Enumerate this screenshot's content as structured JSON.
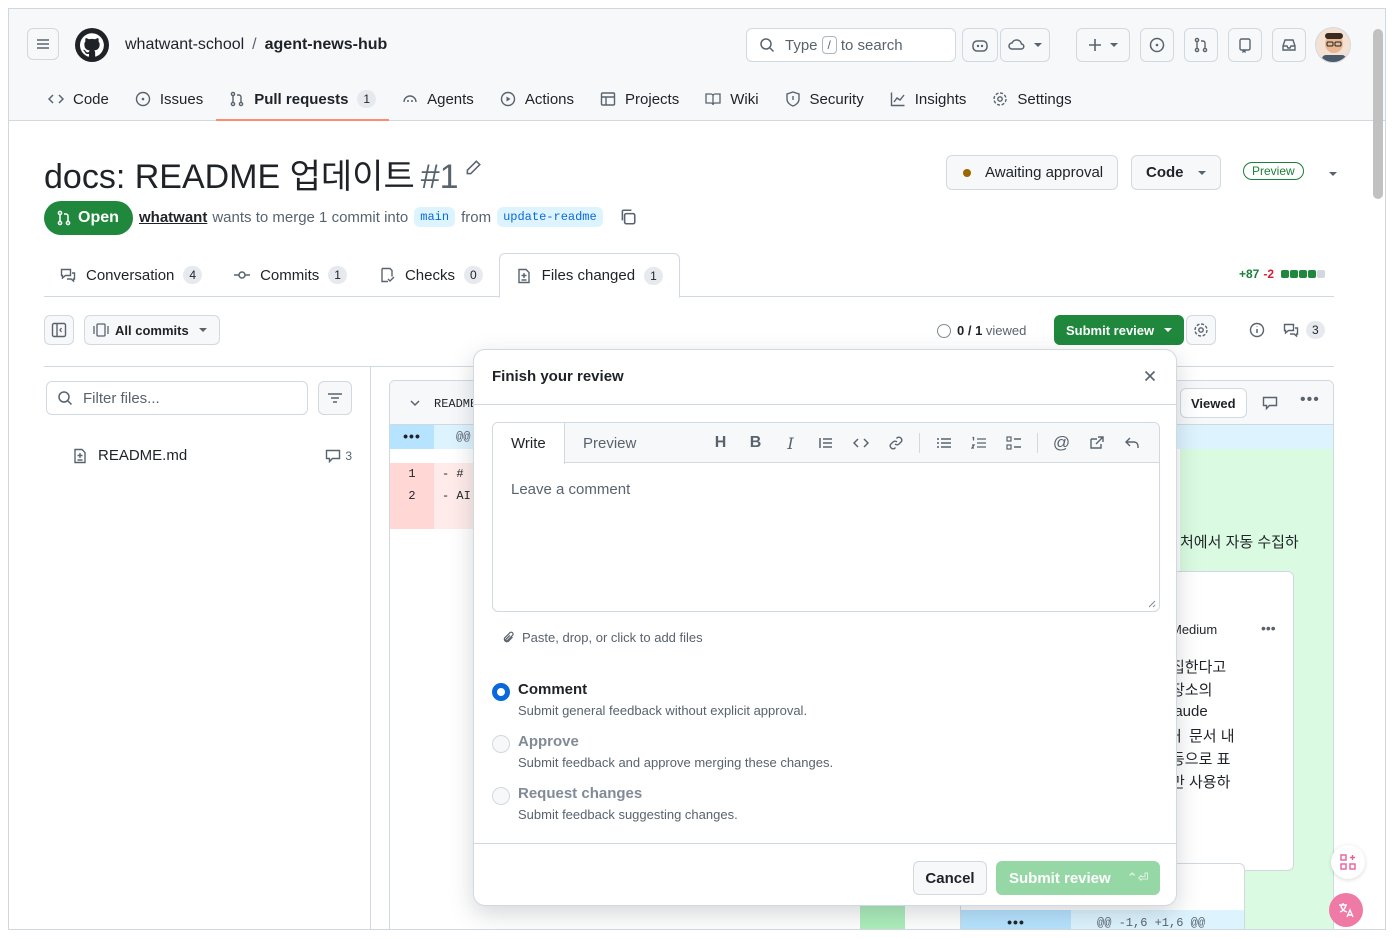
{
  "header": {
    "owner": "whatwant-school",
    "separator": "/",
    "repo": "agent-news-hub",
    "search_prefix": "Type",
    "search_key": "/",
    "search_suffix": "to search"
  },
  "repo_nav": [
    {
      "label": "Code",
      "icon": "code-icon"
    },
    {
      "label": "Issues",
      "icon": "issue-icon"
    },
    {
      "label": "Pull requests",
      "icon": "pull-request-icon",
      "count": "1",
      "active": true
    },
    {
      "label": "Agents",
      "icon": "agent-icon"
    },
    {
      "label": "Actions",
      "icon": "play-icon"
    },
    {
      "label": "Projects",
      "icon": "table-icon"
    },
    {
      "label": "Wiki",
      "icon": "book-icon"
    },
    {
      "label": "Security",
      "icon": "shield-icon"
    },
    {
      "label": "Insights",
      "icon": "graph-icon"
    },
    {
      "label": "Settings",
      "icon": "gear-icon"
    }
  ],
  "pr": {
    "title": "docs: README 업데이트",
    "number": "#1",
    "state": "Open",
    "author": "whatwant",
    "meta_text": "wants to merge 1 commit into",
    "base": "main",
    "from_text": "from",
    "head": "update-readme",
    "awaiting": "Awaiting approval",
    "code_button": "Code",
    "preview_badge": "Preview"
  },
  "tabs": [
    {
      "label": "Conversation",
      "count": "4"
    },
    {
      "label": "Commits",
      "count": "1"
    },
    {
      "label": "Checks",
      "count": "0"
    },
    {
      "label": "Files changed",
      "count": "1",
      "active": true
    }
  ],
  "diffstat": {
    "additions": "+87",
    "deletions": "-2"
  },
  "toolbar": {
    "all_commits": "All commits",
    "viewed_count": "0 / 1",
    "viewed_text": "viewed",
    "submit_review": "Submit review",
    "comment_count": "3"
  },
  "file_tree": {
    "filter_placeholder": "Filter files...",
    "files": [
      {
        "name": "README.md",
        "comments": "3"
      }
    ]
  },
  "diff": {
    "file_label": "README",
    "hunk": "@@",
    "hunk_right": "@@ -1,6 +1,6 @@",
    "viewed_label": "Viewed",
    "lines": [
      {
        "num": "1",
        "code": "- # "
      },
      {
        "num": "2",
        "code": "- AI"
      }
    ],
    "right_snippets": [
      "처에서 자동 수집하",
      "Medium",
      "집한다고",
      "장소의",
      "laude",
      "ㅓ 문서 내",
      "등으로 표",
      "만 사용하"
    ]
  },
  "modal": {
    "title": "Finish your review",
    "write_tab": "Write",
    "preview_tab": "Preview",
    "placeholder": "Leave a comment",
    "attach_text": "Paste, drop, or click to add files",
    "options": [
      {
        "label": "Comment",
        "desc": "Submit general feedback without explicit approval.",
        "selected": true,
        "disabled": false
      },
      {
        "label": "Approve",
        "desc": "Submit feedback and approve merging these changes.",
        "selected": false,
        "disabled": true
      },
      {
        "label": "Request changes",
        "desc": "Submit feedback suggesting changes.",
        "selected": false,
        "disabled": true
      }
    ],
    "cancel": "Cancel",
    "submit": "Submit review"
  },
  "colors": {
    "accent_green": "#1f883d",
    "link_blue": "#0969da",
    "tab_underline": "#fd8c73"
  }
}
